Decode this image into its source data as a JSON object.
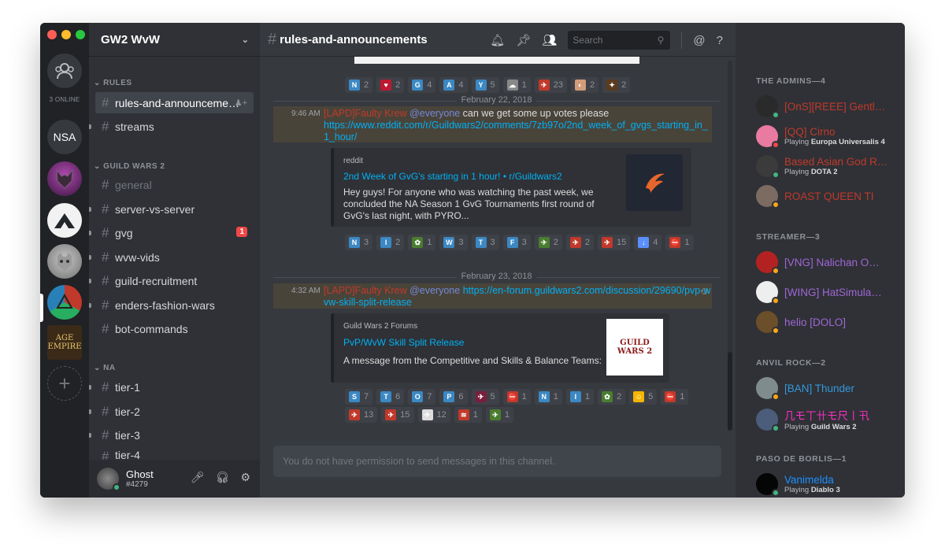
{
  "colors": {
    "accent": "#7289da",
    "online": "#43b581",
    "idle": "#faa61a",
    "dnd": "#f04747",
    "admin_red": "#c0392b",
    "streamer_purple": "#a066d6",
    "anvil_blue": "#3498db",
    "paso_blue": "#1e90ff",
    "pink": "#ff2fc6"
  },
  "rail": {
    "online_count": "3 ONLINE",
    "guilds": [
      {
        "label": "NSA",
        "name": "guild-nsa"
      },
      {
        "label": "",
        "name": "guild-wolf"
      },
      {
        "label": "",
        "name": "guild-white-arrow"
      },
      {
        "label": "",
        "name": "guild-cat"
      },
      {
        "label": "",
        "name": "guild-gw2-wvw"
      },
      {
        "label": "AGE\nEMPIRE",
        "name": "guild-age-of-empires"
      }
    ],
    "add_icon": "plus-icon"
  },
  "sidebar": {
    "guild_name": "GW2 WvW",
    "categories": [
      {
        "name": "RULES",
        "channels": [
          "rules-and-announceme…"
        ]
      },
      {
        "name": "GUILD WARS 2",
        "channels": [
          "general",
          "server-vs-server",
          "gvg",
          "wvw-vids",
          "guild-recruitment",
          "enders-fashion-wars",
          "bot-commands"
        ]
      },
      {
        "name": "NA",
        "channels": [
          "tier-1",
          "tier-2",
          "tier-3",
          "tier-4"
        ]
      }
    ],
    "unstandalone": "streams",
    "gvg_badge": "1"
  },
  "user": {
    "name": "Ghost",
    "tag": "#4279"
  },
  "chat": {
    "channel": "rules-and-announcements",
    "search_placeholder": "Search",
    "reactions_top": [
      {
        "e": "N",
        "c": "2",
        "bg": "#3b88c3"
      },
      {
        "e": "♥",
        "c": "2",
        "bg": "#be1931"
      },
      {
        "e": "G",
        "c": "4",
        "bg": "#3b88c3"
      },
      {
        "e": "A",
        "c": "4",
        "bg": "#3b88c3"
      },
      {
        "e": "Y",
        "c": "5",
        "bg": "#3b88c3"
      },
      {
        "e": "☁",
        "c": "1",
        "bg": "#888"
      },
      {
        "e": "✈",
        "c": "23",
        "bg": "#c0392b"
      },
      {
        "e": "◐",
        "c": "2",
        "bg": "#d39c7a"
      },
      {
        "e": "✦",
        "c": "2",
        "bg": "#5c3a1e"
      }
    ],
    "date1": "February 22, 2018",
    "msg1": {
      "time": "9:46 AM",
      "author": "[LAPD]Faulty Krew",
      "mention": "@everyone",
      "text": " can we get some up votes please",
      "link": "https://www.reddit.com/r/Guildwars2/comments/7zb97o/2nd_week_of_gvgs_starting_in_1_hour/"
    },
    "embed1": {
      "provider": "reddit",
      "title": "2nd Week of GvG's starting in 1 hour! • r/Guildwars2",
      "desc": "Hey guys! For anyone who was watching the past week, we concluded the NA Season 1 GvG Tournaments first round of GvG's last night, with PYRO..."
    },
    "reactions_mid": [
      {
        "e": "N",
        "c": "3",
        "bg": "#3b88c3"
      },
      {
        "e": "I",
        "c": "2",
        "bg": "#3b88c3"
      },
      {
        "e": "✿",
        "c": "1",
        "bg": "#4a7d2f"
      },
      {
        "e": "W",
        "c": "3",
        "bg": "#3b88c3"
      },
      {
        "e": "T",
        "c": "3",
        "bg": "#3b88c3"
      },
      {
        "e": "F",
        "c": "3",
        "bg": "#3b88c3"
      },
      {
        "e": "✈",
        "c": "2",
        "bg": "#4a7d2f"
      },
      {
        "e": "✈",
        "c": "2",
        "bg": "#c0392b"
      },
      {
        "e": "✈",
        "c": "15",
        "bg": "#c0392b"
      },
      {
        "e": "↓",
        "c": "4",
        "bg": "#5b8ff9"
      },
      {
        "e": "⛔",
        "c": "1",
        "bg": "#c0392b"
      }
    ],
    "date2": "February 23, 2018",
    "msg2": {
      "time": "4:32 AM",
      "author": "[LAPD]Faulty Krew",
      "mention": "@everyone",
      "link": "https://en-forum.guildwars2.com/discussion/29690/pvp-wvw-skill-split-release"
    },
    "embed2": {
      "provider": "Guild Wars 2 Forums",
      "title": "PvP/WvW Skill Split Release",
      "desc": "A message from the Competitive and Skills & Balance Teams:",
      "thumb_text": "GUILD WARS 2"
    },
    "reactions_bot": [
      {
        "e": "S",
        "c": "7",
        "bg": "#3b88c3"
      },
      {
        "e": "T",
        "c": "6",
        "bg": "#3b88c3"
      },
      {
        "e": "O",
        "c": "7",
        "bg": "#3b88c3"
      },
      {
        "e": "P",
        "c": "6",
        "bg": "#3b88c3"
      },
      {
        "e": "✈",
        "c": "5",
        "bg": "#7a1f3d"
      },
      {
        "e": "⛔",
        "c": "1",
        "bg": "#c0392b"
      },
      {
        "e": "N",
        "c": "1",
        "bg": "#3b88c3"
      },
      {
        "e": "I",
        "c": "1",
        "bg": "#3b88c3"
      },
      {
        "e": "✿",
        "c": "2",
        "bg": "#4a7d2f"
      },
      {
        "e": "☺",
        "c": "5",
        "bg": "#f4b400"
      },
      {
        "e": "⛔",
        "c": "1",
        "bg": "#c0392b"
      },
      {
        "e": "✈",
        "c": "13",
        "bg": "#c0392b"
      },
      {
        "e": "✈",
        "c": "15",
        "bg": "#c0392b"
      },
      {
        "e": "✈",
        "c": "12",
        "bg": "#ddd"
      },
      {
        "e": "≋",
        "c": "1",
        "bg": "#c0392b"
      },
      {
        "e": "✈",
        "c": "1",
        "bg": "#4a7d2f"
      }
    ],
    "composer_placeholder": "You do not have permission to send messages in this channel."
  },
  "members": {
    "groups": [
      {
        "title": "THE ADMINS—4",
        "items": [
          {
            "name": "[OnS][REEE] Gentl…",
            "game": "",
            "color": "#c0392b",
            "status": "#43b581",
            "av": "#2a2a2a"
          },
          {
            "name": "[QQ] Cirno",
            "game": "Europa Universalis 4",
            "color": "#c0392b",
            "status": "#f04747",
            "av": "#e97aa0"
          },
          {
            "name": "Based Asian God R…",
            "game": "DOTA 2",
            "color": "#c0392b",
            "status": "#43b581",
            "av": "#3b3b3b"
          },
          {
            "name": "ROAST QUEEN TI",
            "game": "",
            "color": "#c0392b",
            "status": "#faa61a",
            "av": "#7b6b60"
          }
        ]
      },
      {
        "title": "STREAMER—3",
        "items": [
          {
            "name": "[VNG] Nalichan O…",
            "game": "",
            "color": "#a066d6",
            "status": "#faa61a",
            "av": "#b22222"
          },
          {
            "name": "[WING] HatSimula…",
            "game": "",
            "color": "#a066d6",
            "status": "#faa61a",
            "av": "#eeeeee"
          },
          {
            "name": "helio [DOLO]",
            "game": "",
            "color": "#a066d6",
            "status": "#faa61a",
            "av": "#6b4f2a"
          }
        ]
      },
      {
        "title": "ANVIL ROCK—2",
        "items": [
          {
            "name": "[BAN] Thunder",
            "game": "",
            "color": "#3498db",
            "status": "#faa61a",
            "av": "#7f8c8d"
          },
          {
            "name": "几モ丅卄モ尺丨卂",
            "game": "Guild Wars 2",
            "color": "#ff2fc6",
            "status": "#43b581",
            "av": "#4b5d7a"
          }
        ]
      },
      {
        "title": "PASO DE BORLIS—1",
        "items": [
          {
            "name": "Vanimelda",
            "game": "Diablo 3",
            "color": "#1e90ff",
            "status": "#43b581",
            "av": "#050505"
          }
        ]
      }
    ],
    "playing_prefix": "Playing "
  }
}
